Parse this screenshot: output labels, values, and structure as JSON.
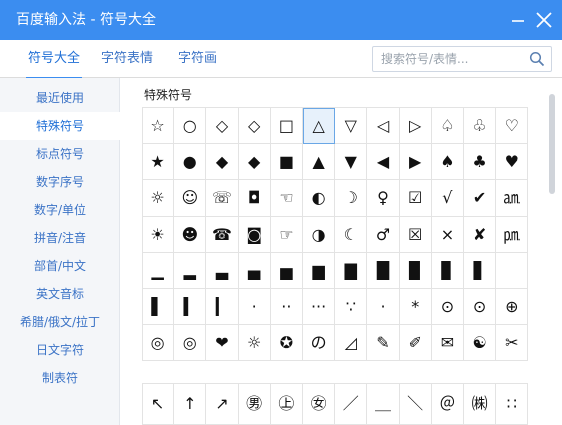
{
  "window": {
    "title": "百度输入法 - 符号大全"
  },
  "tabs": [
    {
      "label": "符号大全",
      "active": true
    },
    {
      "label": "字符表情",
      "active": false
    },
    {
      "label": "字符画",
      "active": false
    }
  ],
  "search": {
    "placeholder": "搜索符号/表情..."
  },
  "sidebar": {
    "items": [
      {
        "label": "最近使用",
        "active": false
      },
      {
        "label": "特殊符号",
        "active": true
      },
      {
        "label": "标点符号",
        "active": false
      },
      {
        "label": "数字序号",
        "active": false
      },
      {
        "label": "数字/单位",
        "active": false
      },
      {
        "label": "拼音/注音",
        "active": false
      },
      {
        "label": "部首/中文",
        "active": false
      },
      {
        "label": "英文音标",
        "active": false
      },
      {
        "label": "希腊/俄文/拉丁",
        "active": false
      },
      {
        "label": "日文字符",
        "active": false
      },
      {
        "label": "制表符",
        "active": false
      }
    ]
  },
  "section": {
    "title": "特殊符号"
  },
  "symbols_grid": [
    [
      "☆",
      "○",
      "◇",
      "◇",
      "□",
      "△",
      "▽",
      "◁",
      "▷",
      "♤",
      "♧",
      "♡"
    ],
    [
      "★",
      "●",
      "◆",
      "◆",
      "■",
      "▲",
      "▼",
      "◀",
      "▶",
      "♠",
      "♣",
      "♥"
    ],
    [
      "☼",
      "☺",
      "☏",
      "◘",
      "☜",
      "◐",
      "☽",
      "♀",
      "☑",
      "√",
      "✔",
      "㏂"
    ],
    [
      "☀",
      "☻",
      "☎",
      "◙",
      "☞",
      "◑",
      "☾",
      "♂",
      "☒",
      "×",
      "✘",
      "㏘"
    ],
    [
      "▁",
      "▂",
      "▃",
      "▄",
      "▅",
      "▆",
      "▇",
      "█",
      "▉",
      "▊",
      "▋",
      ""
    ],
    [
      "▌",
      "▍",
      "▎",
      "▏",
      "",
      "",
      "",
      "",
      "",
      "",
      "",
      ""
    ],
    [
      "◎",
      "◎",
      "❤",
      "☼",
      "✪",
      "の",
      "◿",
      "✎",
      "✐",
      "✉",
      "☯",
      "✂"
    ],
    [
      "↖",
      "↑",
      "↗",
      "㊚",
      "㊤",
      "㊛",
      "／",
      "＿",
      "＼",
      "＠",
      "㈱",
      "∷"
    ]
  ],
  "symbols_grid_cells": {
    "row4": [
      "▁",
      "▂",
      "▃",
      "▄",
      "▅",
      "▆",
      "▇",
      "█",
      "▉",
      "▊",
      "▋"
    ],
    "row5": [
      "▌",
      "▍",
      "▎",
      "·",
      "··",
      "···",
      "∵",
      "·",
      "*",
      "⊙",
      "⊙",
      "⊕"
    ]
  },
  "selected_cell": {
    "row": 0,
    "col": 5
  }
}
